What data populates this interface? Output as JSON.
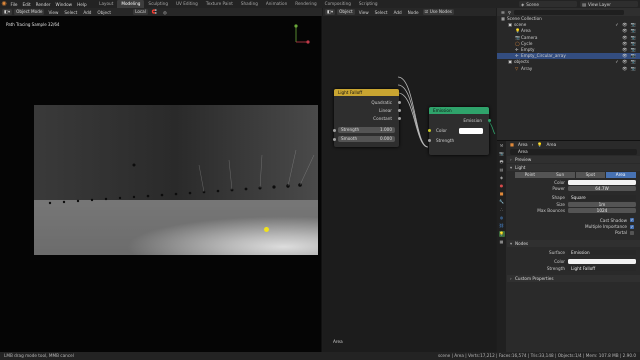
{
  "app": {
    "logo": "blender-logo-icon"
  },
  "menu": [
    "File",
    "Edit",
    "Render",
    "Window",
    "Help"
  ],
  "workspaces": [
    "Layout",
    "Modeling",
    "Sculpting",
    "UV Editing",
    "Texture Paint",
    "Shading",
    "Animation",
    "Rendering",
    "Compositing",
    "Scripting"
  ],
  "active_workspace": "Modeling",
  "topright": {
    "scene": "Scene",
    "view_layer": "View Layer"
  },
  "viewport": {
    "mode": "Object Mode",
    "menus": [
      "View",
      "Select",
      "Add",
      "Object"
    ],
    "transform": "Local",
    "status": "Path Tracing Sample 32/64"
  },
  "node_editor": {
    "mode": "Object",
    "menus": [
      "View",
      "Select",
      "Add",
      "Node"
    ],
    "use_nodes": "Use Nodes",
    "footer": "Area",
    "falloff_node": {
      "title": "Light Falloff",
      "outputs": [
        "Quadratic",
        "Linear",
        "Constant"
      ],
      "strength_label": "Strength",
      "strength_value": "1.000",
      "smooth_label": "Smooth",
      "smooth_value": "0.000",
      "header_color": "#c9a531"
    },
    "emission_node": {
      "title": "Emission",
      "output": "Emission",
      "color_label": "Color",
      "strength_label": "Strength",
      "header_color": "#2fa36b"
    }
  },
  "outliner": {
    "title": "Scene Collection",
    "rows": [
      {
        "label": "Scene Collection",
        "indent": 0,
        "selected": false,
        "vis": ""
      },
      {
        "label": "scene",
        "indent": 1,
        "selected": false,
        "vis": "✓ 👁 📷"
      },
      {
        "label": "Area",
        "indent": 2,
        "selected": false,
        "vis": "👁 📷"
      },
      {
        "label": "Camera",
        "indent": 2,
        "selected": false,
        "vis": "👁 📷"
      },
      {
        "label": "Cycle",
        "indent": 2,
        "selected": false,
        "vis": "👁 📷"
      },
      {
        "label": "Empty",
        "indent": 2,
        "selected": false,
        "vis": "👁 📷"
      },
      {
        "label": "Empty_Circular_array",
        "indent": 2,
        "selected": true,
        "vis": "👁 📷"
      },
      {
        "label": "objects",
        "indent": 1,
        "selected": false,
        "vis": "✓ 👁 📷"
      },
      {
        "label": "Array",
        "indent": 2,
        "selected": false,
        "vis": "👁 📷"
      }
    ]
  },
  "properties": {
    "object_name": "Area",
    "data_name": "Area",
    "name_field": "Area",
    "preview_label": "Preview",
    "light_label": "Light",
    "light_types": [
      "Point",
      "Sun",
      "Spot",
      "Area"
    ],
    "active_light_type": "Area",
    "rows": [
      {
        "label": "Color",
        "value": "",
        "style": "white"
      },
      {
        "label": "Power",
        "value": "64.7W",
        "style": ""
      },
      {
        "label": "Shape",
        "value": "Square",
        "style": "dark"
      },
      {
        "label": "Size",
        "value": "1m",
        "style": ""
      },
      {
        "label": "Max Bounces",
        "value": "1024",
        "style": ""
      }
    ],
    "checks": [
      "Cast Shadow",
      "Multiple Importance",
      "Portal"
    ],
    "nodes_label": "Nodes",
    "surface_label": "Surface",
    "surface_value": "Emission",
    "color_label": "Color",
    "strength_label": "Strength",
    "strength_value": "Light Falloff",
    "custom_props_label": "Custom Properties"
  },
  "statusbar": {
    "left": "LMB drag mode tool, MMB cancel",
    "right": "scene | Area | Verts:17,212 | Faces:16,574 | Tris:33,148 | Objects:1/4 | Mem: 107.8 MB | 2.90.0"
  }
}
